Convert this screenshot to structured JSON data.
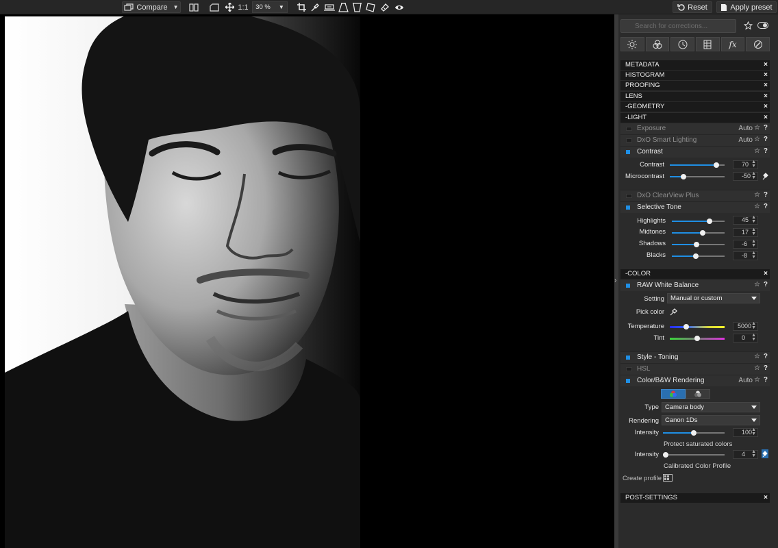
{
  "toolbar": {
    "compare_label": "Compare",
    "ratio_label": "1:1",
    "zoom_value": "30 %",
    "reset_label": "Reset",
    "apply_preset_label": "Apply preset",
    "icons": [
      "compare-icon",
      "split-view-icon",
      "fit-icon",
      "move-icon",
      "crop-icon",
      "eyedropper-icon",
      "horizon-icon",
      "perspective-icon",
      "volume-icon",
      "local-adjust-icon",
      "repair-icon",
      "preview-eye-icon"
    ]
  },
  "panel": {
    "search_placeholder": "Search for corrections...",
    "tabs": [
      "light-tab-icon",
      "color-tab-icon",
      "detail-tab-icon",
      "geometry-tab-icon",
      "effects-tab-icon",
      "local-tab-icon"
    ],
    "fx_label": "fx",
    "sections": {
      "metadata": "METADATA",
      "histogram": "HISTOGRAM",
      "proofing": "PROOFING",
      "lens": "LENS",
      "geometry": "-GEOMETRY",
      "light": "-LIGHT",
      "color": "-COLOR",
      "post": "POST-SETTINGS"
    },
    "close_glyph": "×",
    "star_glyph": "☆",
    "help_glyph": "?",
    "light": {
      "exposure": "Exposure",
      "exposure_auto": "Auto",
      "smart_lighting": "DxO Smart Lighting",
      "smart_lighting_auto": "Auto",
      "contrast_header": "Contrast",
      "contrast_label": "Contrast",
      "contrast_value": "70",
      "microcontrast_label": "Microcontrast",
      "microcontrast_value": "-50",
      "clearview": "DxO ClearView Plus",
      "selective_tone": "Selective Tone",
      "highlights_label": "Highlights",
      "highlights_value": "45",
      "midtones_label": "Midtones",
      "midtones_value": "17",
      "shadows_label": "Shadows",
      "shadows_value": "-6",
      "blacks_label": "Blacks",
      "blacks_value": "-8"
    },
    "color": {
      "wb_header": "RAW White Balance",
      "setting_label": "Setting",
      "setting_value": "Manual or custom",
      "pick_color_label": "Pick color",
      "temperature_label": "Temperature",
      "temperature_value": "5000",
      "tint_label": "Tint",
      "tint_value": "0",
      "style_toning": "Style - Toning",
      "hsl": "HSL",
      "rendering_header": "Color/B&W Rendering",
      "rendering_auto": "Auto",
      "type_label": "Type",
      "type_value": "Camera body",
      "rendering_label": "Rendering",
      "rendering_value": "Canon 1Ds",
      "intensity_label": "Intensity",
      "intensity_value": "100",
      "protect_label": "Protect saturated colors",
      "intensity2_label": "Intensity",
      "intensity2_value": "4",
      "calibrated_label": "Calibrated Color Profile",
      "create_profile_label": "Create profile"
    }
  },
  "colors": {
    "accent": "#1f8fe5",
    "panel_bg": "#2b2b2b",
    "header_bg": "#1a1a1a"
  },
  "sliders": {
    "contrast": 0.85,
    "microcontrast": 0.25,
    "highlights": 0.72,
    "midtones": 0.58,
    "shadows": 0.47,
    "blacks": 0.46,
    "temperature": 0.3,
    "tint": 0.5,
    "intensity": 0.5,
    "intensity2": 0.04
  }
}
